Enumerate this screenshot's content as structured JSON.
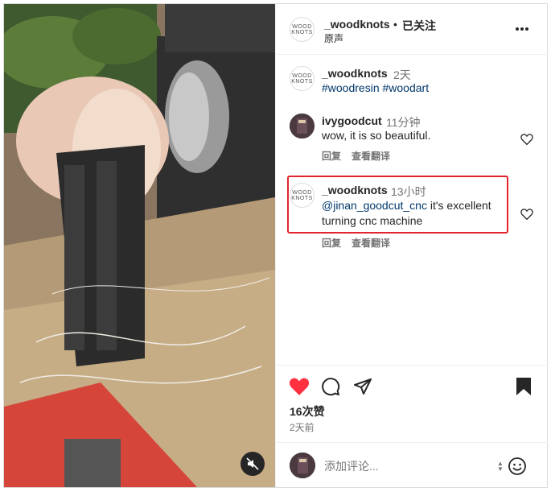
{
  "header": {
    "username": "_woodknots",
    "separator": "•",
    "follow_status": "已关注",
    "audio": "原声",
    "avatar_text": "WOOD KNOTS"
  },
  "caption": {
    "username": "_woodknots",
    "time": "2天",
    "hashtags": "#woodresin #woodart"
  },
  "comments": [
    {
      "username": "ivygoodcut",
      "time": "11分钟",
      "mention": "",
      "text": "wow, it is so beautiful.",
      "reply_label": "回复",
      "translate_label": "查看翻译"
    },
    {
      "username": "_woodknots",
      "time": "13小时",
      "mention": "@jinan_goodcut_cnc",
      "text": " it's excellent turning cnc machine",
      "reply_label": "回复",
      "translate_label": "查看翻译"
    }
  ],
  "stats": {
    "likes": "16次赞",
    "date": "2天前"
  },
  "composer": {
    "placeholder": "添加评论..."
  },
  "colors": {
    "like_red": "#ff3040",
    "highlight_red": "#e3242b",
    "link_blue": "#00376b"
  }
}
